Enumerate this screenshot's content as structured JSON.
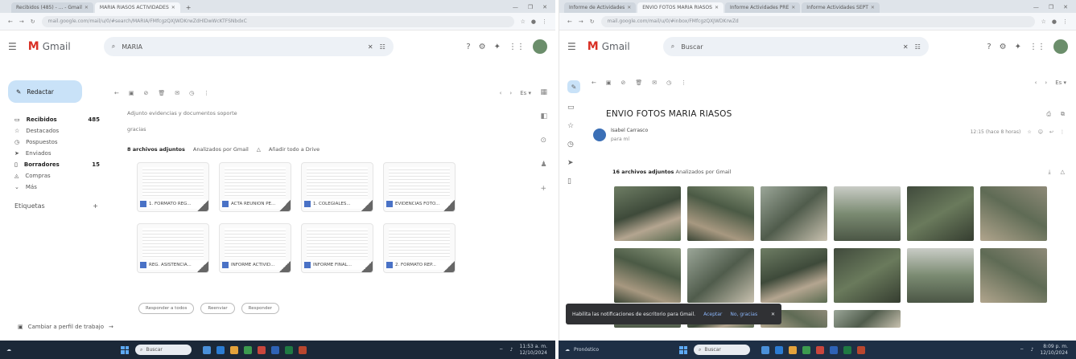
{
  "left": {
    "tabs": [
      {
        "label": "Recibidos (485) - ... - Gmail",
        "active": false
      },
      {
        "label": "MARIA RIASOS ACTIVIDADES",
        "active": true
      }
    ],
    "new_tab": "+",
    "url": "mail.google.com/mail/u/0/#search/MARIA/FMfcgzQXJWDKrwZdHlDwWcKTFSNbdxC",
    "app_name": "Gmail",
    "search_value": "MARIA",
    "compose_label": "Redactar",
    "nav": [
      {
        "label": "Recibidos",
        "count": "485",
        "bold": true
      },
      {
        "label": "Destacados",
        "count": "",
        "bold": false
      },
      {
        "label": "Pospuestos",
        "count": "",
        "bold": false
      },
      {
        "label": "Enviados",
        "count": "",
        "bold": false
      },
      {
        "label": "Borradores",
        "count": "15",
        "bold": true
      },
      {
        "label": "Compras",
        "count": "",
        "bold": false
      },
      {
        "label": "Más",
        "count": "",
        "bold": false
      }
    ],
    "labels_heading": "Etiquetas",
    "body_line1": "Adjunto evidencias y documentos soporte",
    "body_line2": "gracias",
    "attachments_heading": "8 archivos adjuntos",
    "attachments_scan": "Analizados por Gmail",
    "add_to_drive": "Añadir todo a Drive",
    "files": [
      "1. FORMATO REG...",
      "ACTA REUNION PE...",
      "1. COLEGIALES...",
      "EVIDENCIAS FOTO...",
      "REG. ASISTENCIA...",
      "INFORME ACTIVID...",
      "INFORME FINAL...",
      "2. FORMATO REP..."
    ],
    "reply_buttons": [
      "Responder a todos",
      "Reenviar",
      "Responder"
    ],
    "footer": "Cambiar a perfil de trabajo"
  },
  "right": {
    "tabs": [
      {
        "label": "Informe de Actividades",
        "active": false
      },
      {
        "label": "ENVIO FOTOS MARIA RIASOS",
        "active": true
      },
      {
        "label": "Informe Actividades PRE",
        "active": false
      },
      {
        "label": "Informe Actividades SEPT",
        "active": false
      }
    ],
    "url": "mail.google.com/mail/u/0/#inbox/FMfcgzQXJWDKrwZd",
    "app_name": "Gmail",
    "search_value": "Buscar",
    "subject": "ENVIO FOTOS MARIA RIASOS",
    "sender_name": "Isabel Carrasco",
    "sender_to": "para mí",
    "msg_date": "12:15 (hace 8 horas)",
    "attachments_heading": "16 archivos adjuntos",
    "attachments_scan": "Analizados por Gmail",
    "toast_text": "Habilita las notificaciones de escritorio para Gmail.",
    "toast_accept": "Aceptar",
    "toast_dismiss": "No, gracias"
  },
  "taskbar_left": {
    "search": "Buscar",
    "time": "11:53 a. m.",
    "date": "12/10/2024"
  },
  "taskbar_right": {
    "weather": "Pronóstico",
    "search": "Buscar",
    "time": "8:09 p. m.",
    "date": "12/10/2024"
  },
  "colors": {
    "compose_bg": "#c9e2f8",
    "gmail_red": "#d93025",
    "taskbar": "#1b2838",
    "toast": "#303134"
  }
}
